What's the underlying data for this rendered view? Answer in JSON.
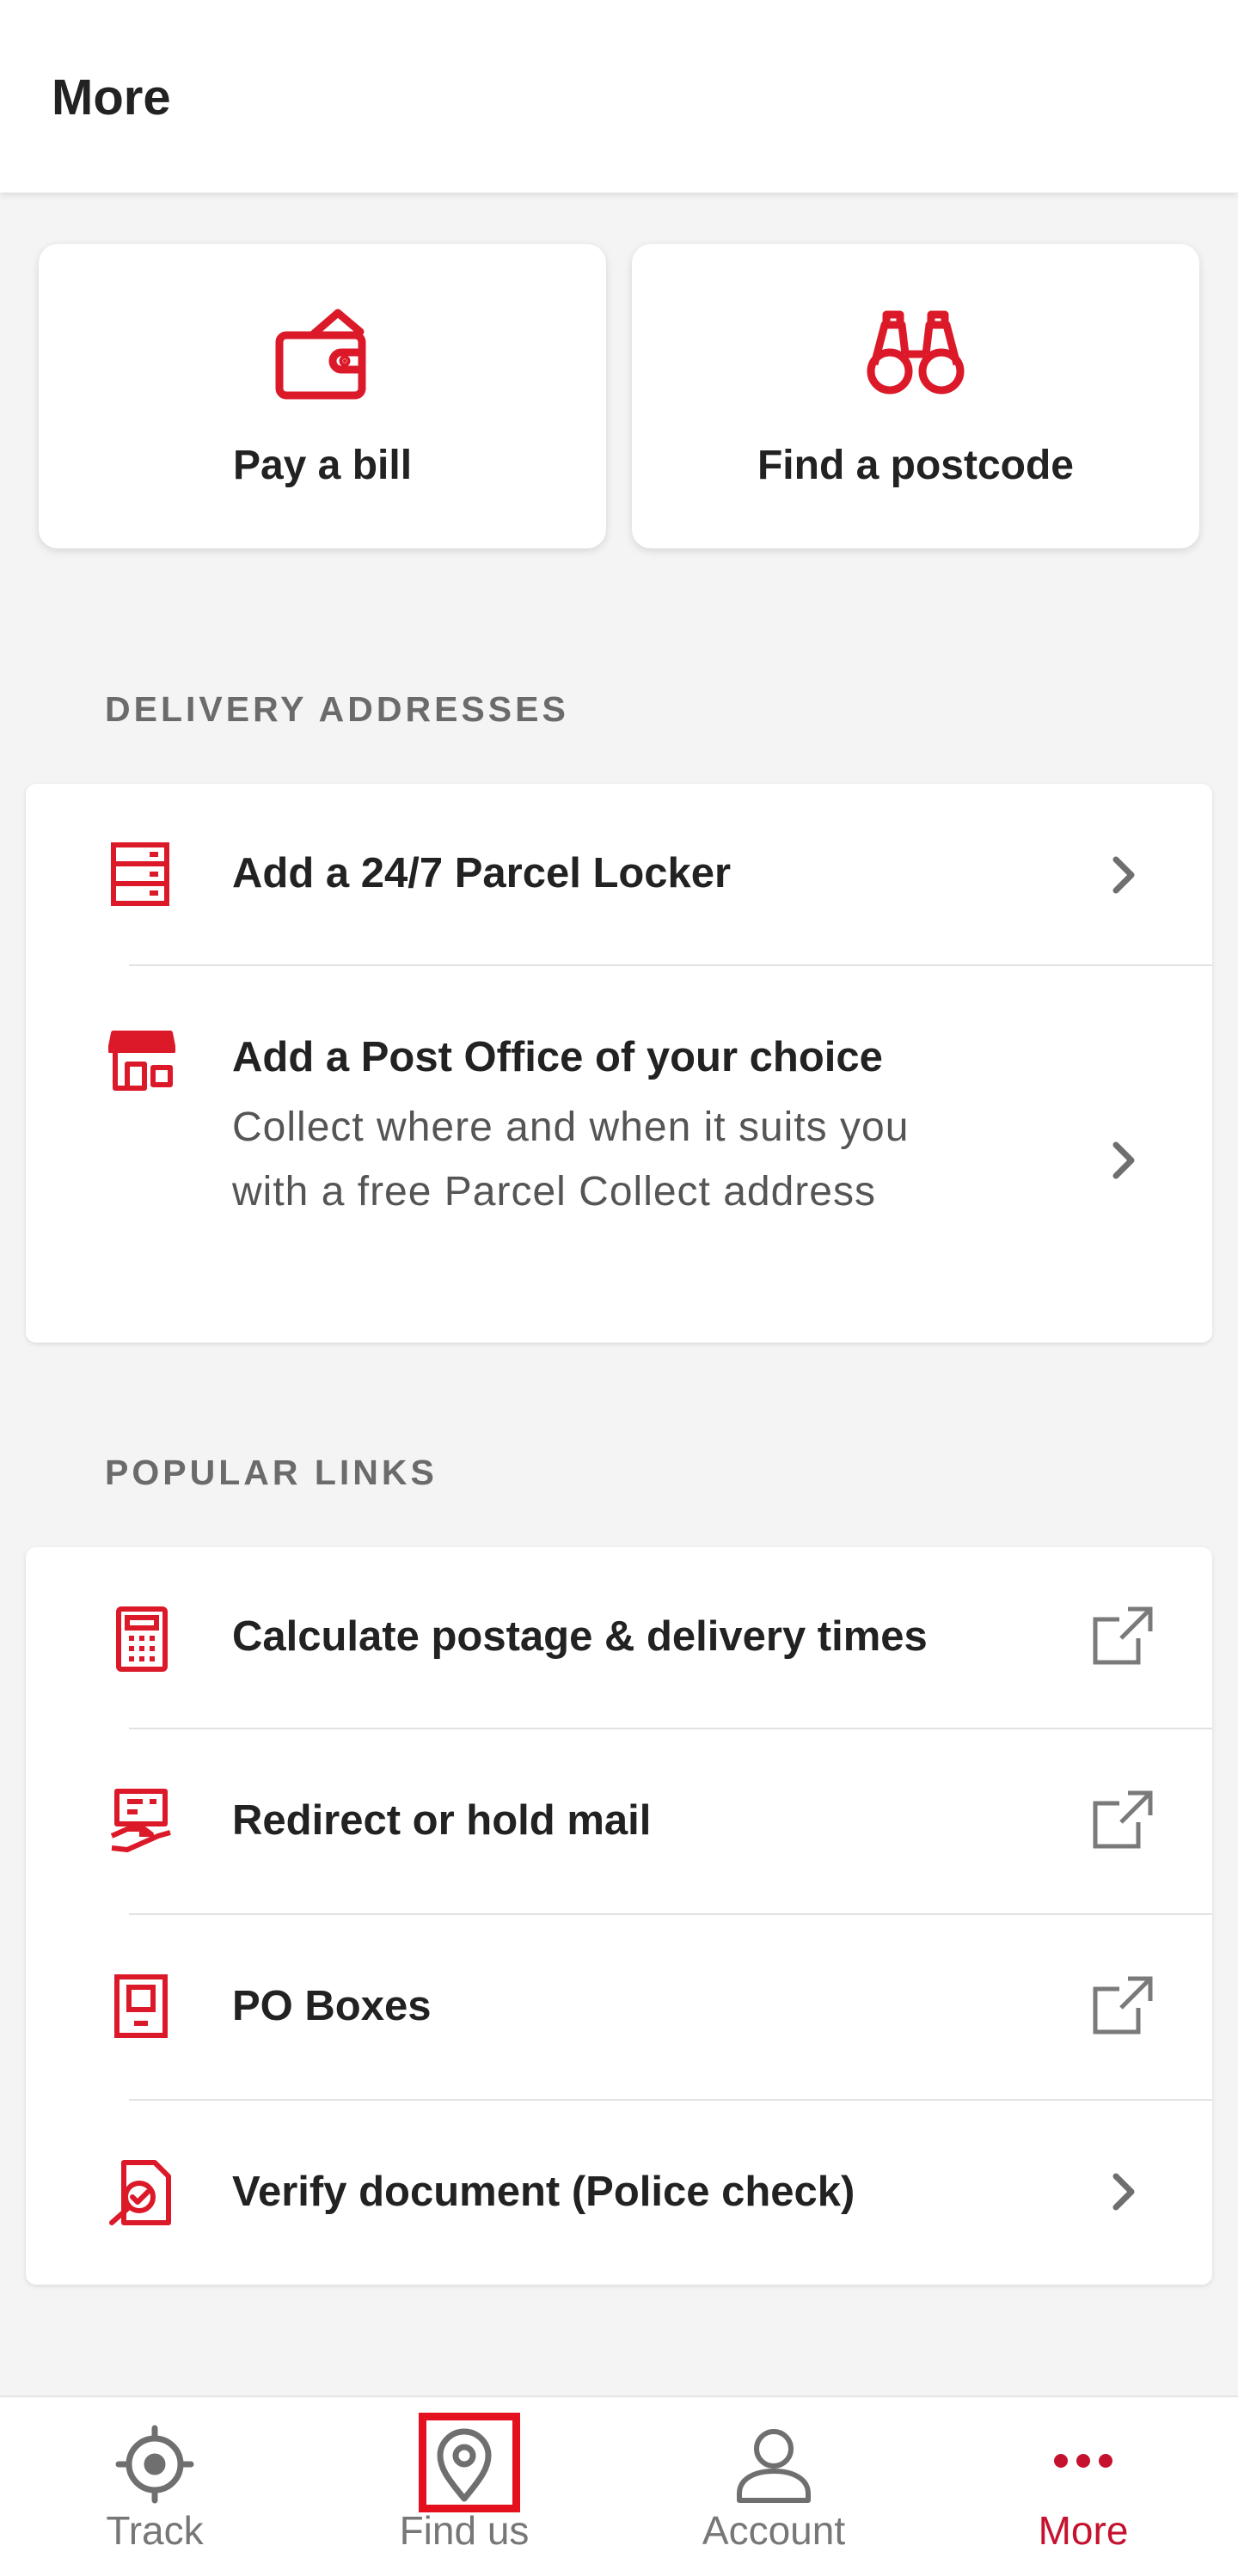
{
  "header": {
    "title": "More"
  },
  "colors": {
    "accent": "#dc1928",
    "tab_active": "#c4122f",
    "highlight_box": "#e5101e"
  },
  "quick_actions": [
    {
      "label": "Pay a bill",
      "icon": "wallet-icon"
    },
    {
      "label": "Find a postcode",
      "icon": "binoculars-icon"
    }
  ],
  "delivery": {
    "title": "DELIVERY ADDRESSES",
    "items": [
      {
        "title": "Add a 24/7 Parcel Locker",
        "icon": "parcel-locker-icon",
        "action": "chevron-right-icon"
      },
      {
        "title": "Add a Post Office of your choice",
        "subtitle": "Collect where and when it suits you with a free Parcel Collect address",
        "icon": "post-office-icon",
        "action": "chevron-right-icon"
      }
    ]
  },
  "popular": {
    "title": "POPULAR LINKS",
    "items": [
      {
        "title": "Calculate postage & delivery times",
        "icon": "calculator-icon",
        "action": "external-link-icon"
      },
      {
        "title": "Redirect or hold mail",
        "icon": "redirect-mail-icon",
        "action": "external-link-icon"
      },
      {
        "title": "PO Boxes",
        "icon": "po-box-icon",
        "action": "external-link-icon"
      },
      {
        "title": "Verify document (Police check)",
        "icon": "verify-document-icon",
        "action": "chevron-right-icon"
      }
    ]
  },
  "tabbar": {
    "items": [
      {
        "label": "Track",
        "icon": "crosshair-icon",
        "active": false
      },
      {
        "label": "Find us",
        "icon": "location-pin-icon",
        "active": false
      },
      {
        "label": "Account",
        "icon": "person-icon",
        "active": false
      },
      {
        "label": "More",
        "icon": "more-dots-icon",
        "active": true
      }
    ]
  }
}
